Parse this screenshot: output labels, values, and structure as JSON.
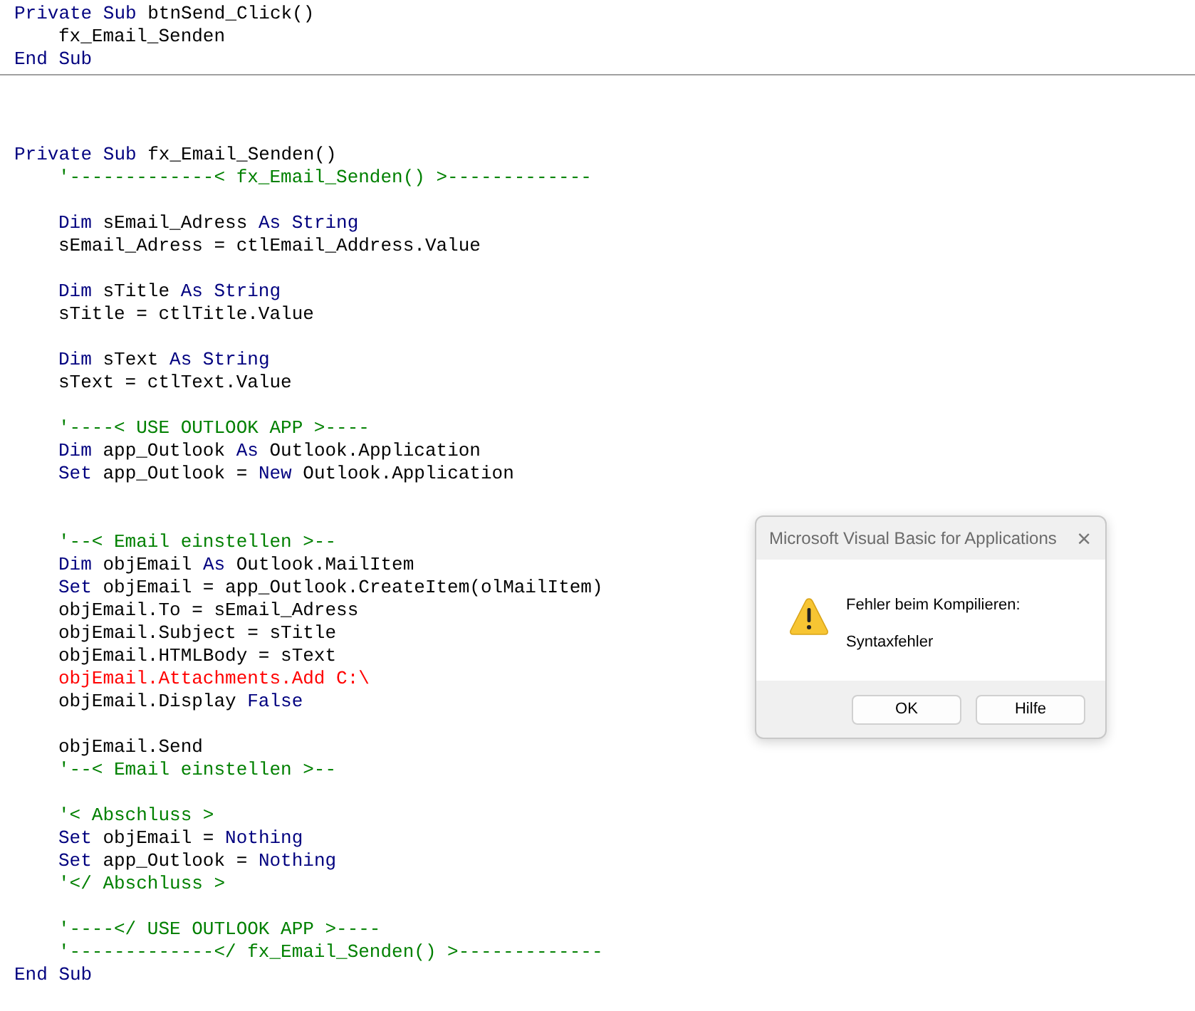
{
  "editor": {
    "sections": [
      {
        "lines": [
          {
            "kind": "code",
            "segments": [
              {
                "kind": "keyword",
                "text": "Private Sub "
              },
              {
                "kind": "plain",
                "text": "btnSend_Click()"
              }
            ],
            "children": [
              {
                "kind": "code",
                "segments": [
                  {
                    "kind": "plain",
                    "text": "fx_Email_Senden"
                  }
                ]
              }
            ]
          },
          {
            "kind": "code",
            "segments": [
              {
                "kind": "keyword",
                "text": "End Sub"
              }
            ]
          }
        ]
      },
      {
        "lines": [
          {
            "kind": "blank"
          },
          {
            "kind": "blank"
          },
          {
            "kind": "blank"
          },
          {
            "kind": "code",
            "segments": [
              {
                "kind": "keyword",
                "text": "Private Sub "
              },
              {
                "kind": "plain",
                "text": "fx_Email_Senden()"
              }
            ],
            "children": [
              {
                "kind": "code",
                "segments": [
                  {
                    "kind": "comment",
                    "text": "'-------------< fx_Email_Senden() >-------------"
                  }
                ]
              },
              {
                "kind": "blank"
              },
              {
                "kind": "code",
                "segments": [
                  {
                    "kind": "keyword",
                    "text": "Dim "
                  },
                  {
                    "kind": "plain",
                    "text": "sEmail_Adress "
                  },
                  {
                    "kind": "keyword",
                    "text": "As String"
                  }
                ]
              },
              {
                "kind": "code",
                "segments": [
                  {
                    "kind": "plain",
                    "text": "sEmail_Adress = ctlEmail_Address.Value"
                  }
                ]
              },
              {
                "kind": "blank"
              },
              {
                "kind": "code",
                "segments": [
                  {
                    "kind": "keyword",
                    "text": "Dim "
                  },
                  {
                    "kind": "plain",
                    "text": "sTitle "
                  },
                  {
                    "kind": "keyword",
                    "text": "As String"
                  }
                ]
              },
              {
                "kind": "code",
                "segments": [
                  {
                    "kind": "plain",
                    "text": "sTitle = ctlTitle.Value"
                  }
                ]
              },
              {
                "kind": "blank"
              },
              {
                "kind": "code",
                "segments": [
                  {
                    "kind": "keyword",
                    "text": "Dim "
                  },
                  {
                    "kind": "plain",
                    "text": "sText "
                  },
                  {
                    "kind": "keyword",
                    "text": "As String"
                  }
                ]
              },
              {
                "kind": "code",
                "segments": [
                  {
                    "kind": "plain",
                    "text": "sText = ctlText.Value"
                  }
                ]
              },
              {
                "kind": "blank"
              },
              {
                "kind": "code",
                "segments": [
                  {
                    "kind": "comment",
                    "text": "'----< USE OUTLOOK APP >----"
                  }
                ]
              },
              {
                "kind": "code",
                "segments": [
                  {
                    "kind": "keyword",
                    "text": "Dim "
                  },
                  {
                    "kind": "plain",
                    "text": "app_Outlook "
                  },
                  {
                    "kind": "keyword",
                    "text": "As "
                  },
                  {
                    "kind": "plain",
                    "text": "Outlook.Application"
                  }
                ]
              },
              {
                "kind": "code",
                "segments": [
                  {
                    "kind": "keyword",
                    "text": "Set "
                  },
                  {
                    "kind": "plain",
                    "text": "app_Outlook = "
                  },
                  {
                    "kind": "keyword",
                    "text": "New "
                  },
                  {
                    "kind": "plain",
                    "text": "Outlook.Application"
                  }
                ]
              },
              {
                "kind": "blank"
              },
              {
                "kind": "blank"
              },
              {
                "kind": "code",
                "segments": [
                  {
                    "kind": "comment",
                    "text": "'--< Email einstellen >--"
                  }
                ]
              },
              {
                "kind": "code",
                "segments": [
                  {
                    "kind": "keyword",
                    "text": "Dim "
                  },
                  {
                    "kind": "plain",
                    "text": "objEmail "
                  },
                  {
                    "kind": "keyword",
                    "text": "As "
                  },
                  {
                    "kind": "plain",
                    "text": "Outlook.MailItem"
                  }
                ]
              },
              {
                "kind": "code",
                "segments": [
                  {
                    "kind": "keyword",
                    "text": "Set "
                  },
                  {
                    "kind": "plain",
                    "text": "objEmail = app_Outlook.CreateItem(olMailItem)"
                  }
                ]
              },
              {
                "kind": "code",
                "segments": [
                  {
                    "kind": "plain",
                    "text": "objEmail.To = sEmail_Adress"
                  }
                ]
              },
              {
                "kind": "code",
                "segments": [
                  {
                    "kind": "plain",
                    "text": "objEmail.Subject = sTitle"
                  }
                ]
              },
              {
                "kind": "code",
                "segments": [
                  {
                    "kind": "plain",
                    "text": "objEmail.HTMLBody = sText"
                  }
                ]
              },
              {
                "kind": "code",
                "segments": [
                  {
                    "kind": "error",
                    "text": "objEmail.Attachments.Add C:\\"
                  }
                ]
              },
              {
                "kind": "code",
                "segments": [
                  {
                    "kind": "plain",
                    "text": "objEmail.Display "
                  },
                  {
                    "kind": "keyword",
                    "text": "False"
                  }
                ]
              },
              {
                "kind": "blank"
              },
              {
                "kind": "code",
                "segments": [
                  {
                    "kind": "plain",
                    "text": "objEmail.Send"
                  }
                ]
              },
              {
                "kind": "code",
                "segments": [
                  {
                    "kind": "comment",
                    "text": "'--< Email einstellen >--"
                  }
                ]
              },
              {
                "kind": "blank"
              },
              {
                "kind": "code",
                "segments": [
                  {
                    "kind": "comment",
                    "text": "'< Abschluss >"
                  }
                ]
              },
              {
                "kind": "code",
                "segments": [
                  {
                    "kind": "keyword",
                    "text": "Set "
                  },
                  {
                    "kind": "plain",
                    "text": "objEmail = "
                  },
                  {
                    "kind": "keyword",
                    "text": "Nothing"
                  }
                ]
              },
              {
                "kind": "code",
                "segments": [
                  {
                    "kind": "keyword",
                    "text": "Set "
                  },
                  {
                    "kind": "plain",
                    "text": "app_Outlook = "
                  },
                  {
                    "kind": "keyword",
                    "text": "Nothing"
                  }
                ]
              },
              {
                "kind": "code",
                "segments": [
                  {
                    "kind": "comment",
                    "text": "'</ Abschluss >"
                  }
                ]
              },
              {
                "kind": "blank"
              },
              {
                "kind": "code",
                "segments": [
                  {
                    "kind": "comment",
                    "text": "'----</ USE OUTLOOK APP >----"
                  }
                ]
              },
              {
                "kind": "code",
                "segments": [
                  {
                    "kind": "comment",
                    "text": "'-------------</ fx_Email_Senden() >-------------"
                  }
                ]
              }
            ]
          },
          {
            "kind": "code",
            "segments": [
              {
                "kind": "keyword",
                "text": "End Sub"
              }
            ]
          }
        ]
      }
    ]
  },
  "dialog": {
    "title": "Microsoft Visual Basic for Applications",
    "close": "×",
    "message": "Fehler beim Kompilieren:",
    "detail": "Syntaxfehler",
    "buttons": [
      "OK",
      "Hilfe"
    ]
  }
}
